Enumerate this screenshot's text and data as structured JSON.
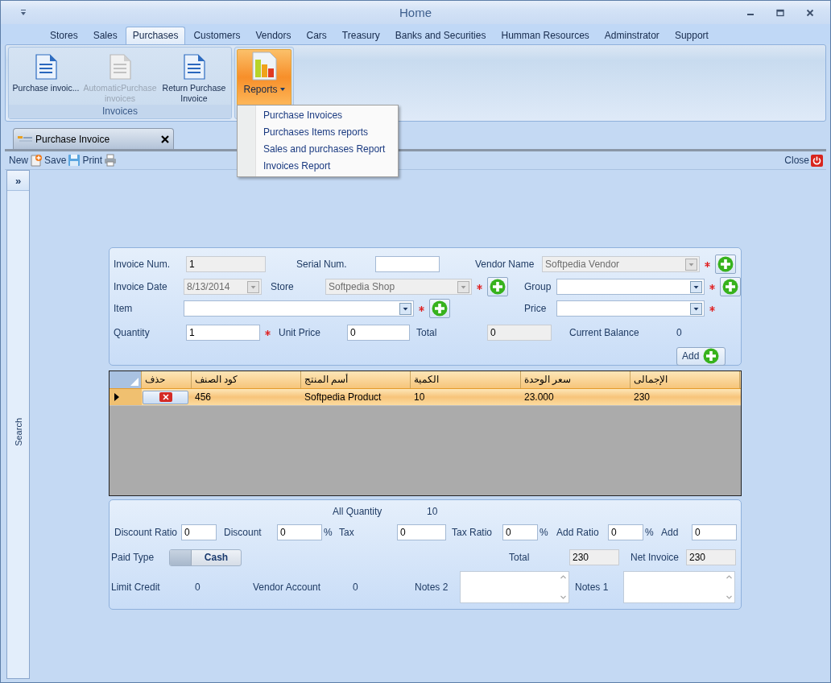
{
  "window": {
    "title": "Home"
  },
  "ribbon_tabs": [
    {
      "label": "Stores",
      "selected": false
    },
    {
      "label": "Sales",
      "selected": false
    },
    {
      "label": "Purchases",
      "selected": true
    },
    {
      "label": "Customers",
      "selected": false
    },
    {
      "label": "Vendors",
      "selected": false
    },
    {
      "label": "Cars",
      "selected": false
    },
    {
      "label": "Treasury",
      "selected": false
    },
    {
      "label": "Banks and Securities",
      "selected": false
    },
    {
      "label": "Humman Resources",
      "selected": false
    },
    {
      "label": "Adminstrator",
      "selected": false
    },
    {
      "label": "Support",
      "selected": false
    }
  ],
  "ribbon": {
    "group": {
      "label": "Invoices",
      "buttons": [
        {
          "label": "Purchase invoic...",
          "disabled": false
        },
        {
          "label": "AutomaticPurchase invoices",
          "disabled": true
        },
        {
          "label": "Return Purchase Invoice",
          "disabled": false
        }
      ]
    },
    "reports_button": {
      "label": "Reports",
      "expanded": true
    }
  },
  "reports_menu": [
    "Purchase Invoices",
    "Purchases Items reports",
    "Sales and purchases Report",
    "Invoices Report"
  ],
  "document_tab": {
    "title": "Purchase Invoice"
  },
  "toolbar": {
    "buttons": [
      "New",
      "Save",
      "Print"
    ],
    "close": "Close"
  },
  "search_panel": {
    "toggle": "»",
    "label": "Search"
  },
  "invoice_form": {
    "fields": [
      {
        "label": "Invoice Num.",
        "kind": "readonly",
        "value": "1"
      },
      {
        "label": "Serial Num.",
        "kind": "input"
      },
      {
        "label": "Vendor Name",
        "kind": "combo",
        "value": "Softpedia Vendor",
        "disabled": true,
        "required": true,
        "add": true
      },
      {
        "label": "Invoice Date",
        "kind": "combo",
        "value": "8/13/2014",
        "disabled": true
      },
      {
        "label": "Store",
        "kind": "combo",
        "value": "Softpedia Shop",
        "disabled": true,
        "required": true,
        "add": true
      },
      {
        "label": "Group",
        "kind": "combo",
        "disabled": false,
        "required": true,
        "add": true
      },
      {
        "label": "Item",
        "kind": "combo",
        "disabled": false,
        "required": true,
        "add": true
      },
      {
        "label": "Price",
        "kind": "combo",
        "disabled": false,
        "required": true
      },
      {
        "label": "Quantity",
        "kind": "input",
        "value": "1",
        "required": true
      },
      {
        "label": "Unit Price",
        "kind": "input",
        "value": "0"
      },
      {
        "label": "Total",
        "kind": "readonly",
        "value": "0"
      },
      {
        "label": "Current Balance",
        "kind": "value",
        "value": "0"
      }
    ],
    "add_button": "Add"
  },
  "items_grid": {
    "delete_column": "حذف",
    "columns": [
      "كود الصنف",
      "أسم المنتج",
      "الكمية",
      "سعر الوحدة",
      "الإجمالى"
    ],
    "rows": [
      {
        "selected": true,
        "cells": [
          "456",
          "Softpedia Product",
          "10",
          "23.000",
          "230"
        ]
      }
    ]
  },
  "totals_form": {
    "fields": [
      {
        "label": "All Quantity",
        "kind": "value",
        "value": "10"
      },
      {
        "label": "Discount Ratio",
        "kind": "input",
        "value": "0"
      },
      {
        "label": "Discount",
        "kind": "input",
        "value": "0",
        "suffix": "%"
      },
      {
        "label": "Tax",
        "kind": "input",
        "value": "0"
      },
      {
        "label": "Tax Ratio",
        "kind": "input",
        "value": "0",
        "suffix": "%"
      },
      {
        "label": "Add Ratio",
        "kind": "input",
        "value": "0",
        "suffix": "%"
      },
      {
        "label": "Add",
        "kind": "input",
        "value": "0"
      },
      {
        "label": "Paid Type",
        "kind": "toggle",
        "value": "Cash",
        "on": false
      },
      {
        "label": "Total",
        "kind": "readonly",
        "value": "230"
      },
      {
        "label": "Net Invoice",
        "kind": "readonly",
        "value": "230"
      },
      {
        "label": "Limit Credit",
        "kind": "value",
        "value": "0"
      },
      {
        "label": "Vendor Account",
        "kind": "value",
        "value": "0"
      },
      {
        "label": "Notes 2",
        "kind": "textarea"
      },
      {
        "label": "Notes 1",
        "kind": "textarea"
      }
    ]
  }
}
